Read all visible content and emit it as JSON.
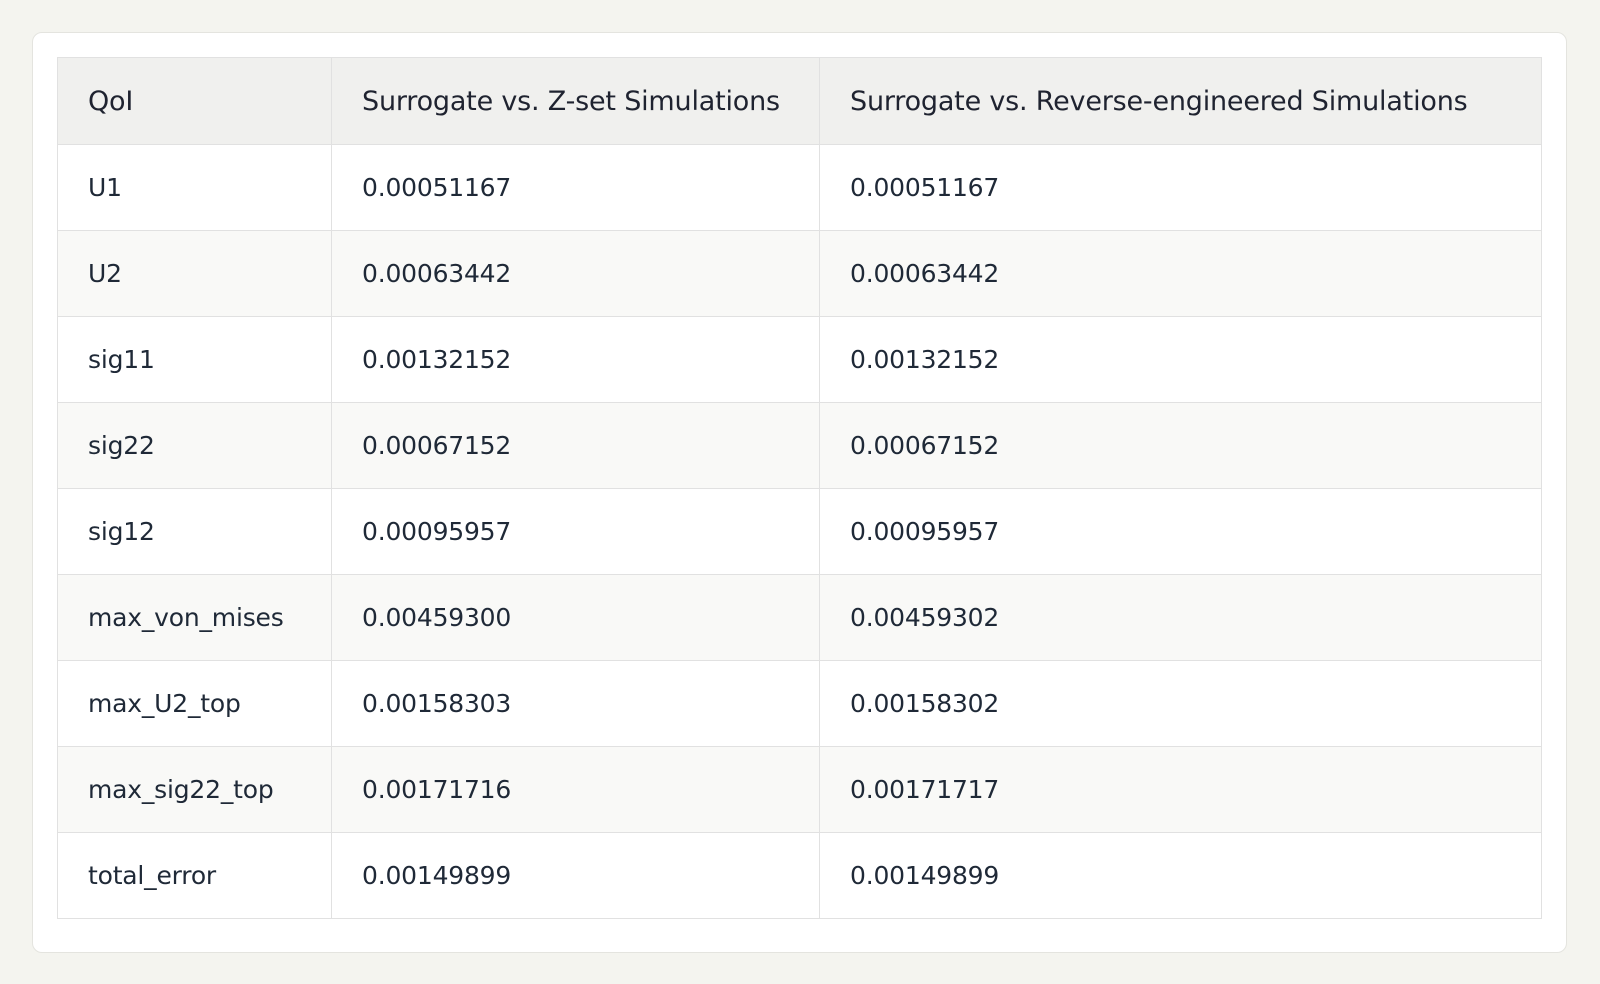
{
  "table": {
    "headers": [
      "QoI",
      "Surrogate vs. Z-set Simulations",
      "Surrogate vs. Reverse-engineered Simulations"
    ],
    "rows": [
      [
        "U1",
        "0.00051167",
        "0.00051167"
      ],
      [
        "U2",
        "0.00063442",
        "0.00063442"
      ],
      [
        "sig11",
        "0.00132152",
        "0.00132152"
      ],
      [
        "sig22",
        "0.00067152",
        "0.00067152"
      ],
      [
        "sig12",
        "0.00095957",
        "0.00095957"
      ],
      [
        "max_von_mises",
        "0.00459300",
        "0.00459302"
      ],
      [
        "max_U2_top",
        "0.00158303",
        "0.00158302"
      ],
      [
        "max_sig22_top",
        "0.00171716",
        "0.00171717"
      ],
      [
        "total_error",
        "0.00149899",
        "0.00149899"
      ]
    ]
  }
}
